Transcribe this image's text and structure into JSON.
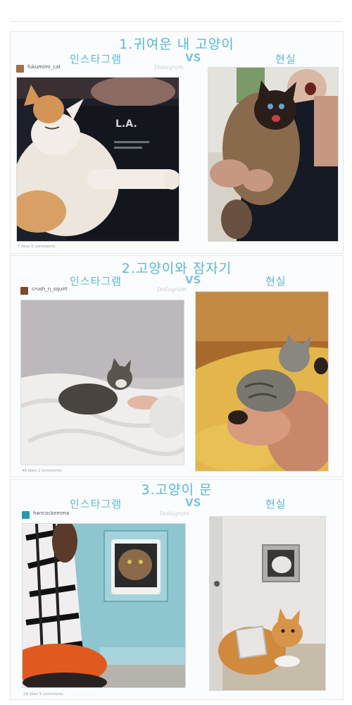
{
  "sections": [
    {
      "title": "1.귀여운 내 고양이",
      "left_label": "인스타그램",
      "vs_label": "VS",
      "right_label": "현실",
      "username": "fukumimi_cat",
      "logo": "Instagram",
      "footer": "7 likes   0 comments"
    },
    {
      "title": "2.고양이와 잠자기",
      "left_label": "인스타그램",
      "vs_label": "VS",
      "right_label": "현실",
      "username": "crush_n_squirt",
      "logo": "Instagram",
      "footer": "46 likes   2 comments"
    },
    {
      "title": "3.고양이 문",
      "left_label": "인스타그램",
      "vs_label": "VS",
      "right_label": "현실",
      "username": "hancockemma",
      "logo": "Instagram",
      "footer": "28 likes   5 comments"
    }
  ],
  "colors": {
    "accent": "#57b7d6",
    "border": "#e3e9ec"
  }
}
